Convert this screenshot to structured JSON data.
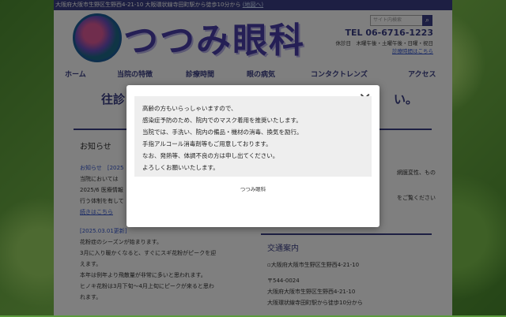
{
  "topbar": {
    "address": "大阪府大阪市生野区生野西4-21-10 大阪環状線寺田町駅から徒歩10分から",
    "map_link": "(地図へ)"
  },
  "header": {
    "logo_text": "つつみ眼科",
    "search_placeholder": "サイト内検索",
    "tel": "TEL 06-6716-1223",
    "closed_days": "休診日　木曜午後・土曜午後・日曜・祝日",
    "closed_link": "診療時間はこちら"
  },
  "nav": {
    "items": [
      "ホーム",
      "当院の特徴",
      "診療時間",
      "眼の病気",
      "コンタクトレンズ",
      "アクセス"
    ]
  },
  "banner": {
    "left": "往診",
    "right": "い。"
  },
  "news": {
    "title": "お知らせ",
    "item1_label": "お知らせ",
    "item1_date": "[2025",
    "item1_line1": "当院においては",
    "item1_line2": "2025/6 医療情報",
    "item1_line3": "行う体制を有して",
    "item1_more": "続きはこちら",
    "item2_date": "[2025.03.01更新]",
    "item2_lines": [
      "花粉症のシーズンが始まります。",
      "3月に入り暖かくなると、すぐにスギ花粉がピークを迎",
      "えます。",
      "本年は例年より飛散量が非常に多いと思われます。",
      "ヒノキ花粉は3月下旬〜4月上旬にピークが来ると思わ",
      "れます。"
    ]
  },
  "right_snip": {
    "line1": "網膜変性、もの",
    "line2": "をご覧ください"
  },
  "access": {
    "title": "交通案内",
    "image_alt": "大阪府大阪市生野区生野西4-21-10",
    "postal": "〒544-0024",
    "address": "大阪府大阪市生野区生野西4-21-10",
    "directions": "大阪環状線寺田町駅から徒歩10分から"
  },
  "modal": {
    "close_label": "✕",
    "lines": [
      "高齢の方もいらっしゃいますので、",
      "感染症予防のため、院内でのマスク着用を推奨いたします。",
      "当院では、手洗い、院内の備品・機材の消毒、換気を励行。",
      "手指アルコール消毒剤等もご用意しております。",
      "なお、発熱等、体調不良の方は申し出てください。",
      "よろしくお願いいたします。"
    ],
    "footer": "つつみ眼科"
  }
}
